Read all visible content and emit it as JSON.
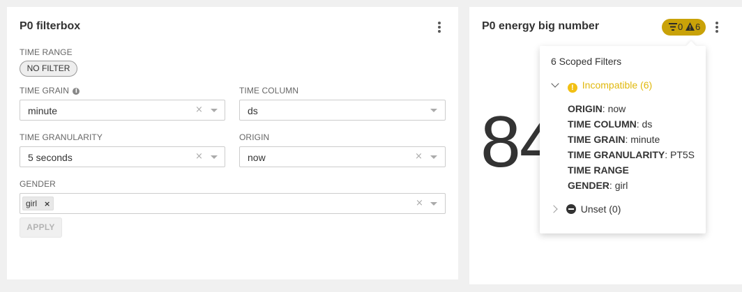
{
  "filterbox": {
    "title": "P0 filterbox",
    "time_range_label": "TIME RANGE",
    "time_range_value": "NO FILTER",
    "time_grain_label": "TIME GRAIN",
    "time_grain_value": "minute",
    "time_column_label": "TIME COLUMN",
    "time_column_value": "ds",
    "time_granularity_label": "TIME GRANULARITY",
    "time_granularity_value": "5 seconds",
    "origin_label": "ORIGIN",
    "origin_value": "now",
    "gender_label": "GENDER",
    "gender_tags": [
      "girl"
    ],
    "apply_label": "APPLY"
  },
  "bignumber": {
    "title": "P0 energy big number",
    "badge_filters_count": "0",
    "badge_warnings_count": "6",
    "value_visible": "84"
  },
  "popover": {
    "header": "6 Scoped Filters",
    "incompatible_label": "Incompatible (6)",
    "unset_label": "Unset (0)",
    "filters": [
      {
        "name": "ORIGIN",
        "value": "now"
      },
      {
        "name": "TIME COLUMN",
        "value": "ds"
      },
      {
        "name": "TIME GRAIN",
        "value": "minute"
      },
      {
        "name": "TIME GRANULARITY",
        "value": "PT5S"
      },
      {
        "name": "TIME RANGE",
        "value": ""
      },
      {
        "name": "GENDER",
        "value": "girl"
      }
    ]
  },
  "colors": {
    "warning_badge": "#c9a208",
    "incompatible_text": "#e0b80c",
    "warning_icon": "#f2c014"
  },
  "icons": {
    "filter": "filter-icon",
    "warning": "warning-triangle-icon",
    "info": "info-icon",
    "menu": "more-vertical-icon"
  }
}
